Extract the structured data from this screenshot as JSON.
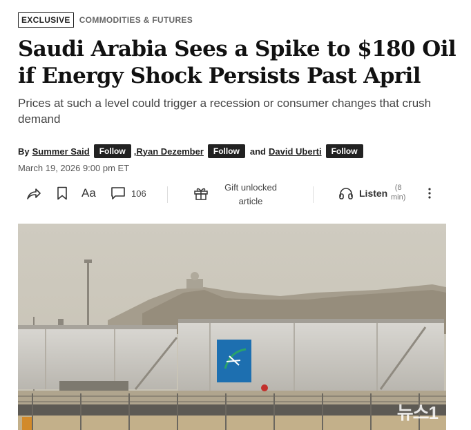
{
  "article": {
    "exclusive_tag": "EXCLUSIVE",
    "section": "COMMODITIES & FUTURES",
    "headline": "Saudi Arabia Sees a Spike to $180 Oil if Energy Shock Persists Past April",
    "dek": "Prices at such a level could trigger a recession or consumer changes that crush demand",
    "byline": {
      "prefix": "By",
      "authors": [
        "Summer Said",
        "Ryan Dezember",
        "David Uberti"
      ],
      "separator_comma": ",",
      "separator_and": "and",
      "follow_label": "Follow"
    },
    "timestamp": "March 19, 2026 9:00 pm ET"
  },
  "toolbar": {
    "share_icon": "share-icon",
    "bookmark_icon": "bookmark-icon",
    "text_size_label": "Aa",
    "comments_count": "106",
    "gift_label_line1": "Gift unlocked",
    "gift_label_line2": "article",
    "listen_label": "Listen",
    "listen_duration_line1": "(8",
    "listen_duration_line2": "min)",
    "more_icon": "more-vertical-icon"
  },
  "photo": {
    "tank_logo_colors": [
      "#1d6fb0",
      "#2aa36b"
    ],
    "watermark": "뉴스1"
  }
}
